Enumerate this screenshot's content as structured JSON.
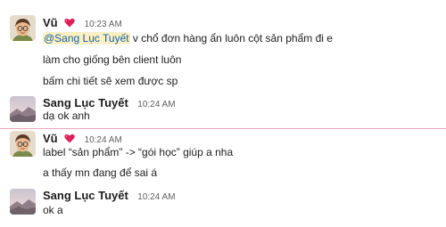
{
  "messages": [
    {
      "sender": "Vũ",
      "time": "10:23 AM",
      "has_heart": true,
      "avatar": "cartoon-boy-avatar",
      "mention": "@Sang Lục Tuyết",
      "lines": [
        " v chổ đơn hàng ẩn luôn cột sản phẩm đi e",
        "làm cho giống bên client luôn",
        "bấm chi tiết sẽ xem được sp"
      ]
    },
    {
      "sender": "Sang Lục Tuyết",
      "time": "10:24 AM",
      "avatar": "landscape-avatar",
      "lines": [
        "dạ ok anh"
      ]
    },
    {
      "sender": "Vũ",
      "time": "10:24 AM",
      "has_heart": true,
      "avatar": "cartoon-boy-avatar",
      "lines": [
        "label “sản phẩm” -> “gói học” giúp a nha",
        "a thấy mn đang để sai á"
      ]
    },
    {
      "sender": "Sang Lục Tuyết",
      "time": "10:24 AM",
      "avatar": "landscape-avatar",
      "lines": [
        "ok a"
      ]
    }
  ],
  "colors": {
    "mention_bg": "#fcefc4",
    "mention_text": "#1264a3",
    "new_divider": "#e8a7b7",
    "heart": "#e01e5a"
  }
}
